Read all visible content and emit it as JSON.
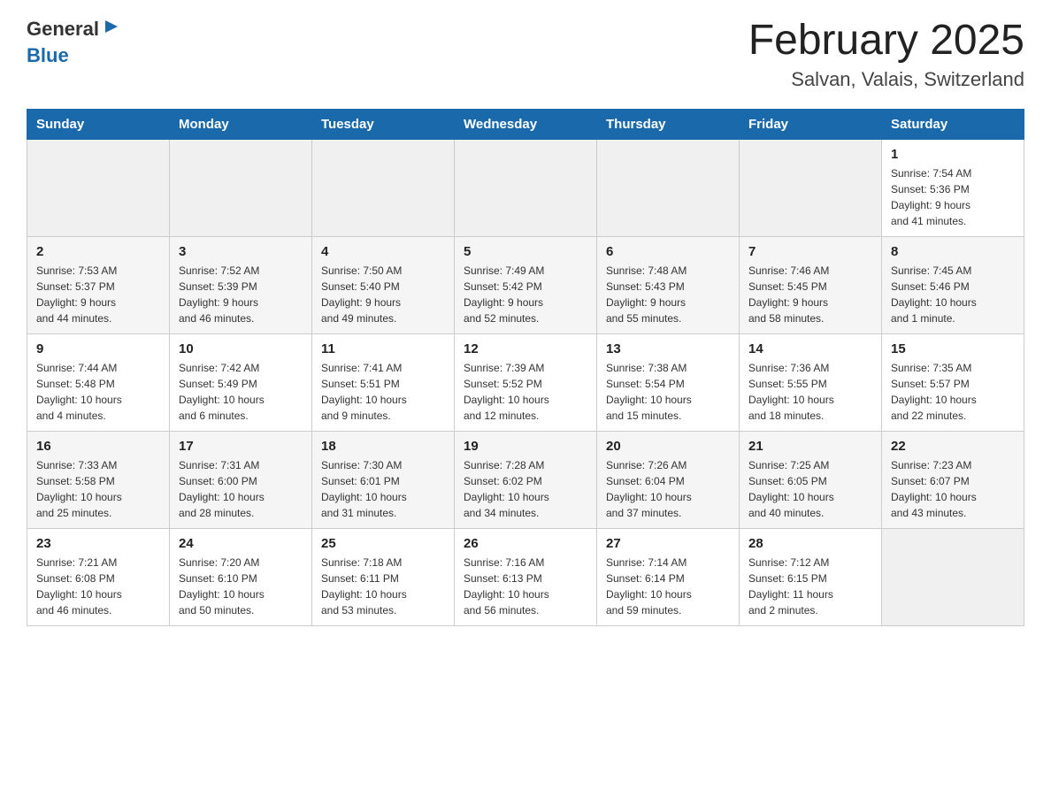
{
  "header": {
    "logo_general": "General",
    "logo_blue": "Blue",
    "title": "February 2025",
    "subtitle": "Salvan, Valais, Switzerland"
  },
  "weekdays": [
    "Sunday",
    "Monday",
    "Tuesday",
    "Wednesday",
    "Thursday",
    "Friday",
    "Saturday"
  ],
  "weeks": [
    [
      {
        "day": "",
        "info": ""
      },
      {
        "day": "",
        "info": ""
      },
      {
        "day": "",
        "info": ""
      },
      {
        "day": "",
        "info": ""
      },
      {
        "day": "",
        "info": ""
      },
      {
        "day": "",
        "info": ""
      },
      {
        "day": "1",
        "info": "Sunrise: 7:54 AM\nSunset: 5:36 PM\nDaylight: 9 hours\nand 41 minutes."
      }
    ],
    [
      {
        "day": "2",
        "info": "Sunrise: 7:53 AM\nSunset: 5:37 PM\nDaylight: 9 hours\nand 44 minutes."
      },
      {
        "day": "3",
        "info": "Sunrise: 7:52 AM\nSunset: 5:39 PM\nDaylight: 9 hours\nand 46 minutes."
      },
      {
        "day": "4",
        "info": "Sunrise: 7:50 AM\nSunset: 5:40 PM\nDaylight: 9 hours\nand 49 minutes."
      },
      {
        "day": "5",
        "info": "Sunrise: 7:49 AM\nSunset: 5:42 PM\nDaylight: 9 hours\nand 52 minutes."
      },
      {
        "day": "6",
        "info": "Sunrise: 7:48 AM\nSunset: 5:43 PM\nDaylight: 9 hours\nand 55 minutes."
      },
      {
        "day": "7",
        "info": "Sunrise: 7:46 AM\nSunset: 5:45 PM\nDaylight: 9 hours\nand 58 minutes."
      },
      {
        "day": "8",
        "info": "Sunrise: 7:45 AM\nSunset: 5:46 PM\nDaylight: 10 hours\nand 1 minute."
      }
    ],
    [
      {
        "day": "9",
        "info": "Sunrise: 7:44 AM\nSunset: 5:48 PM\nDaylight: 10 hours\nand 4 minutes."
      },
      {
        "day": "10",
        "info": "Sunrise: 7:42 AM\nSunset: 5:49 PM\nDaylight: 10 hours\nand 6 minutes."
      },
      {
        "day": "11",
        "info": "Sunrise: 7:41 AM\nSunset: 5:51 PM\nDaylight: 10 hours\nand 9 minutes."
      },
      {
        "day": "12",
        "info": "Sunrise: 7:39 AM\nSunset: 5:52 PM\nDaylight: 10 hours\nand 12 minutes."
      },
      {
        "day": "13",
        "info": "Sunrise: 7:38 AM\nSunset: 5:54 PM\nDaylight: 10 hours\nand 15 minutes."
      },
      {
        "day": "14",
        "info": "Sunrise: 7:36 AM\nSunset: 5:55 PM\nDaylight: 10 hours\nand 18 minutes."
      },
      {
        "day": "15",
        "info": "Sunrise: 7:35 AM\nSunset: 5:57 PM\nDaylight: 10 hours\nand 22 minutes."
      }
    ],
    [
      {
        "day": "16",
        "info": "Sunrise: 7:33 AM\nSunset: 5:58 PM\nDaylight: 10 hours\nand 25 minutes."
      },
      {
        "day": "17",
        "info": "Sunrise: 7:31 AM\nSunset: 6:00 PM\nDaylight: 10 hours\nand 28 minutes."
      },
      {
        "day": "18",
        "info": "Sunrise: 7:30 AM\nSunset: 6:01 PM\nDaylight: 10 hours\nand 31 minutes."
      },
      {
        "day": "19",
        "info": "Sunrise: 7:28 AM\nSunset: 6:02 PM\nDaylight: 10 hours\nand 34 minutes."
      },
      {
        "day": "20",
        "info": "Sunrise: 7:26 AM\nSunset: 6:04 PM\nDaylight: 10 hours\nand 37 minutes."
      },
      {
        "day": "21",
        "info": "Sunrise: 7:25 AM\nSunset: 6:05 PM\nDaylight: 10 hours\nand 40 minutes."
      },
      {
        "day": "22",
        "info": "Sunrise: 7:23 AM\nSunset: 6:07 PM\nDaylight: 10 hours\nand 43 minutes."
      }
    ],
    [
      {
        "day": "23",
        "info": "Sunrise: 7:21 AM\nSunset: 6:08 PM\nDaylight: 10 hours\nand 46 minutes."
      },
      {
        "day": "24",
        "info": "Sunrise: 7:20 AM\nSunset: 6:10 PM\nDaylight: 10 hours\nand 50 minutes."
      },
      {
        "day": "25",
        "info": "Sunrise: 7:18 AM\nSunset: 6:11 PM\nDaylight: 10 hours\nand 53 minutes."
      },
      {
        "day": "26",
        "info": "Sunrise: 7:16 AM\nSunset: 6:13 PM\nDaylight: 10 hours\nand 56 minutes."
      },
      {
        "day": "27",
        "info": "Sunrise: 7:14 AM\nSunset: 6:14 PM\nDaylight: 10 hours\nand 59 minutes."
      },
      {
        "day": "28",
        "info": "Sunrise: 7:12 AM\nSunset: 6:15 PM\nDaylight: 11 hours\nand 2 minutes."
      },
      {
        "day": "",
        "info": ""
      }
    ]
  ]
}
